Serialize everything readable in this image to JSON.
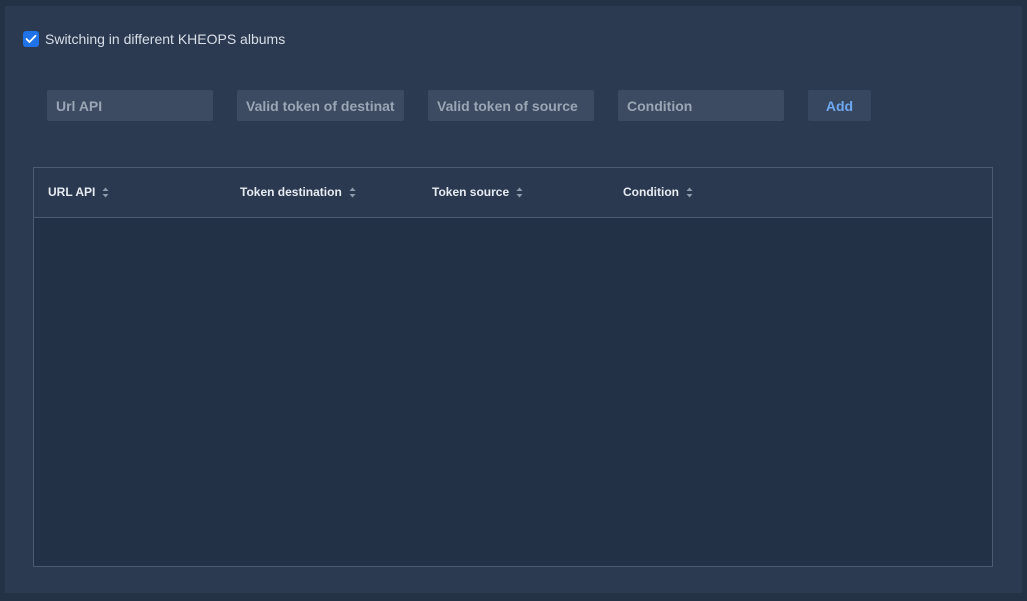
{
  "switching": {
    "label": "Switching in different KHEOPS albums",
    "checked": true
  },
  "form": {
    "url_placeholder": "Url API",
    "dest_placeholder": "Valid token of destination",
    "source_placeholder": "Valid token of source",
    "condition_placeholder": "Condition",
    "add_label": "Add"
  },
  "table": {
    "columns": [
      "URL API",
      "Token destination",
      "Token source",
      "Condition"
    ],
    "rows": []
  },
  "colors": {
    "background": "#243246",
    "panel": "#2b3a50",
    "accent": "#1f72e8",
    "button_text": "#6fa8f0"
  },
  "icons": {
    "checkbox": "checkmark-icon",
    "sort": "sort-icon"
  }
}
